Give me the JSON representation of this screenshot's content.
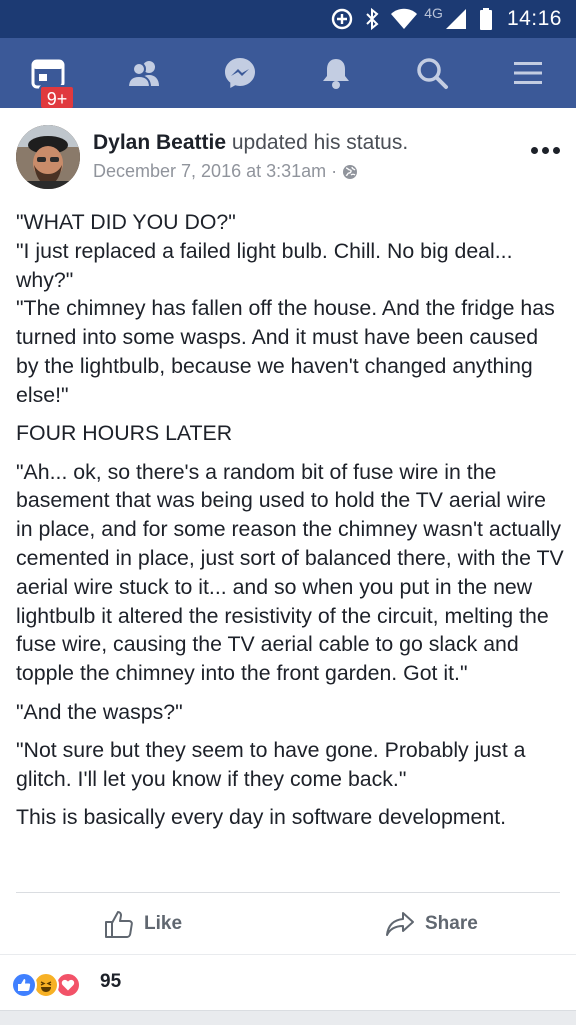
{
  "status_bar": {
    "time": "14:16",
    "network": "4G"
  },
  "nav": {
    "tabs": [
      {
        "icon": "news-feed-icon"
      },
      {
        "icon": "friends-icon"
      },
      {
        "icon": "messenger-icon"
      },
      {
        "icon": "notifications-bell-icon"
      },
      {
        "icon": "search-icon"
      },
      {
        "icon": "menu-icon"
      }
    ],
    "badge": "9+"
  },
  "post": {
    "author": "Dylan Beattie",
    "action": " updated his status.",
    "timestamp": "December 7, 2016 at 3:31am",
    "separator": "·",
    "privacy_icon": "globe-icon",
    "paragraphs": {
      "p1": "\"WHAT DID YOU DO?\"",
      "p2": "\"I just replaced a failed light bulb. Chill. No big deal... why?\"",
      "p3": "\"The chimney has fallen off the house. And the fridge has turned into some wasps. And it must have been caused by the lightbulb, because we haven't changed anything else!\"",
      "p4": "FOUR HOURS LATER",
      "p5": "\"Ah... ok, so there's a random bit of fuse wire in the basement that was being used to hold the TV aerial wire in place, and for some reason the chimney wasn't actually cemented in place, just sort of balanced there, with the TV aerial wire stuck to it... and so when you put in the new lightbulb it altered the resistivity of the circuit, melting the fuse wire, causing the TV aerial cable to go slack and topple the chimney into the front garden. Got it.\"",
      "p6": "\"And the wasps?\"",
      "p7": "\"Not sure but they seem to have gone. Probably just a glitch. I'll let you know if they come back.\"",
      "p8": "This is basically every day in software development."
    },
    "actions": {
      "like": "Like",
      "share": "Share"
    }
  },
  "reactions": {
    "types": [
      "like",
      "haha",
      "love"
    ],
    "colors": {
      "like": "#4080ff",
      "haha": "#f7b125",
      "love": "#f25268"
    },
    "count": "95"
  },
  "colors": {
    "brand": "#3b5998",
    "status_bar": "#1c3a73",
    "badge": "#e0393e"
  }
}
